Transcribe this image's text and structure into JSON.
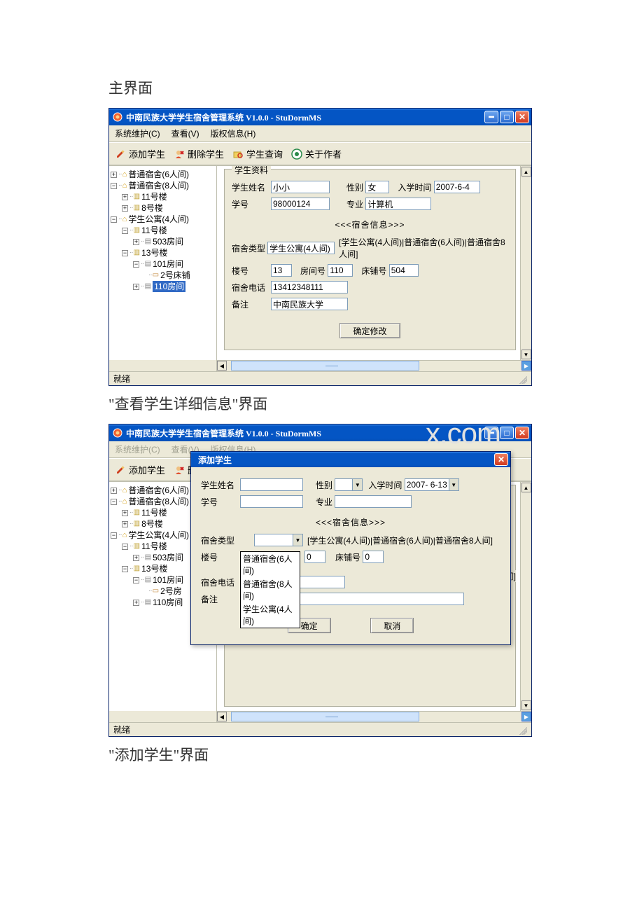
{
  "captions": {
    "c1": "主界面",
    "c2": "\"查看学生详细信息\"界面",
    "c3": "\"添加学生\"界面"
  },
  "app": {
    "title": "中南民族大学学生宿舍管理系统  V1.0.0 - StuDormMS",
    "menu": {
      "m1": "系统维护(C)",
      "m2": "查看(V)",
      "m3": "版权信息(H)"
    },
    "toolbar": {
      "add": "添加学生",
      "del": "删除学生",
      "query": "学生查询",
      "about": "关于作者"
    },
    "status": "就绪"
  },
  "tree": {
    "n1": "普通宿舍(6人间)",
    "n2": "普通宿舍(8人间)",
    "n2a": "11号楼",
    "n2b": "8号楼",
    "n3": "学生公寓(4人间)",
    "n3a": "11号楼",
    "n3a1": "503房间",
    "n3b": "13号楼",
    "n3b1": "101房间",
    "n3b1a": "2号床铺",
    "n3b2": "110房间",
    "tree2_n3b1a": "2号房",
    "tree2_n3b2": "110房间"
  },
  "form": {
    "legend": "学生资料",
    "name_l": "学生姓名",
    "name_v": "小小",
    "gender_l": "性别",
    "gender_v": "女",
    "enroll_l": "入学时间",
    "enroll_v": "2007-6-4",
    "sid_l": "学号",
    "sid_v": "98000124",
    "major_l": "专业",
    "major_v": "计算机",
    "dorm_section": "<<<宿舍信息>>>",
    "type_l": "宿舍类型",
    "type_v": "学生公寓(4人间)",
    "type_hint": "[学生公寓(4人间)|普通宿舍(6人间)|普通宿舍8人间]",
    "building_l": "楼号",
    "building_v": "13",
    "room_l": "房间号",
    "room_v": "110",
    "bed_l": "床铺号",
    "bed_v": "504",
    "phone_l": "宿舍电话",
    "phone_v": "13412348111",
    "note_l": "备注",
    "note_v": "中南民族大学",
    "confirm": "确定修改"
  },
  "dialog": {
    "title": "添加学生",
    "name_l": "学生姓名",
    "gender_l": "性别",
    "enroll_l": "入学时间",
    "enroll_v": "2007- 6-13",
    "sid_l": "学号",
    "major_l": "专业",
    "dorm_section": "<<<宿舍信息>>>",
    "type_l": "宿舍类型",
    "type_hint": "[学生公寓(4人间)|普通宿舍(6人间)|普通宿舍8人间]",
    "building_l": "楼号",
    "room_v": "0",
    "bed_l": "床铺号",
    "bed_v": "0",
    "phone_l": "宿舍电话",
    "note_l": "备注",
    "ok": "确定",
    "cancel": "取消",
    "dropdown": {
      "o1": "普通宿舍(6人间)",
      "o2": "普通宿舍(8人间)",
      "o3": "学生公寓(4人间)"
    },
    "peek": "8人间]"
  },
  "watermark": "x.com"
}
